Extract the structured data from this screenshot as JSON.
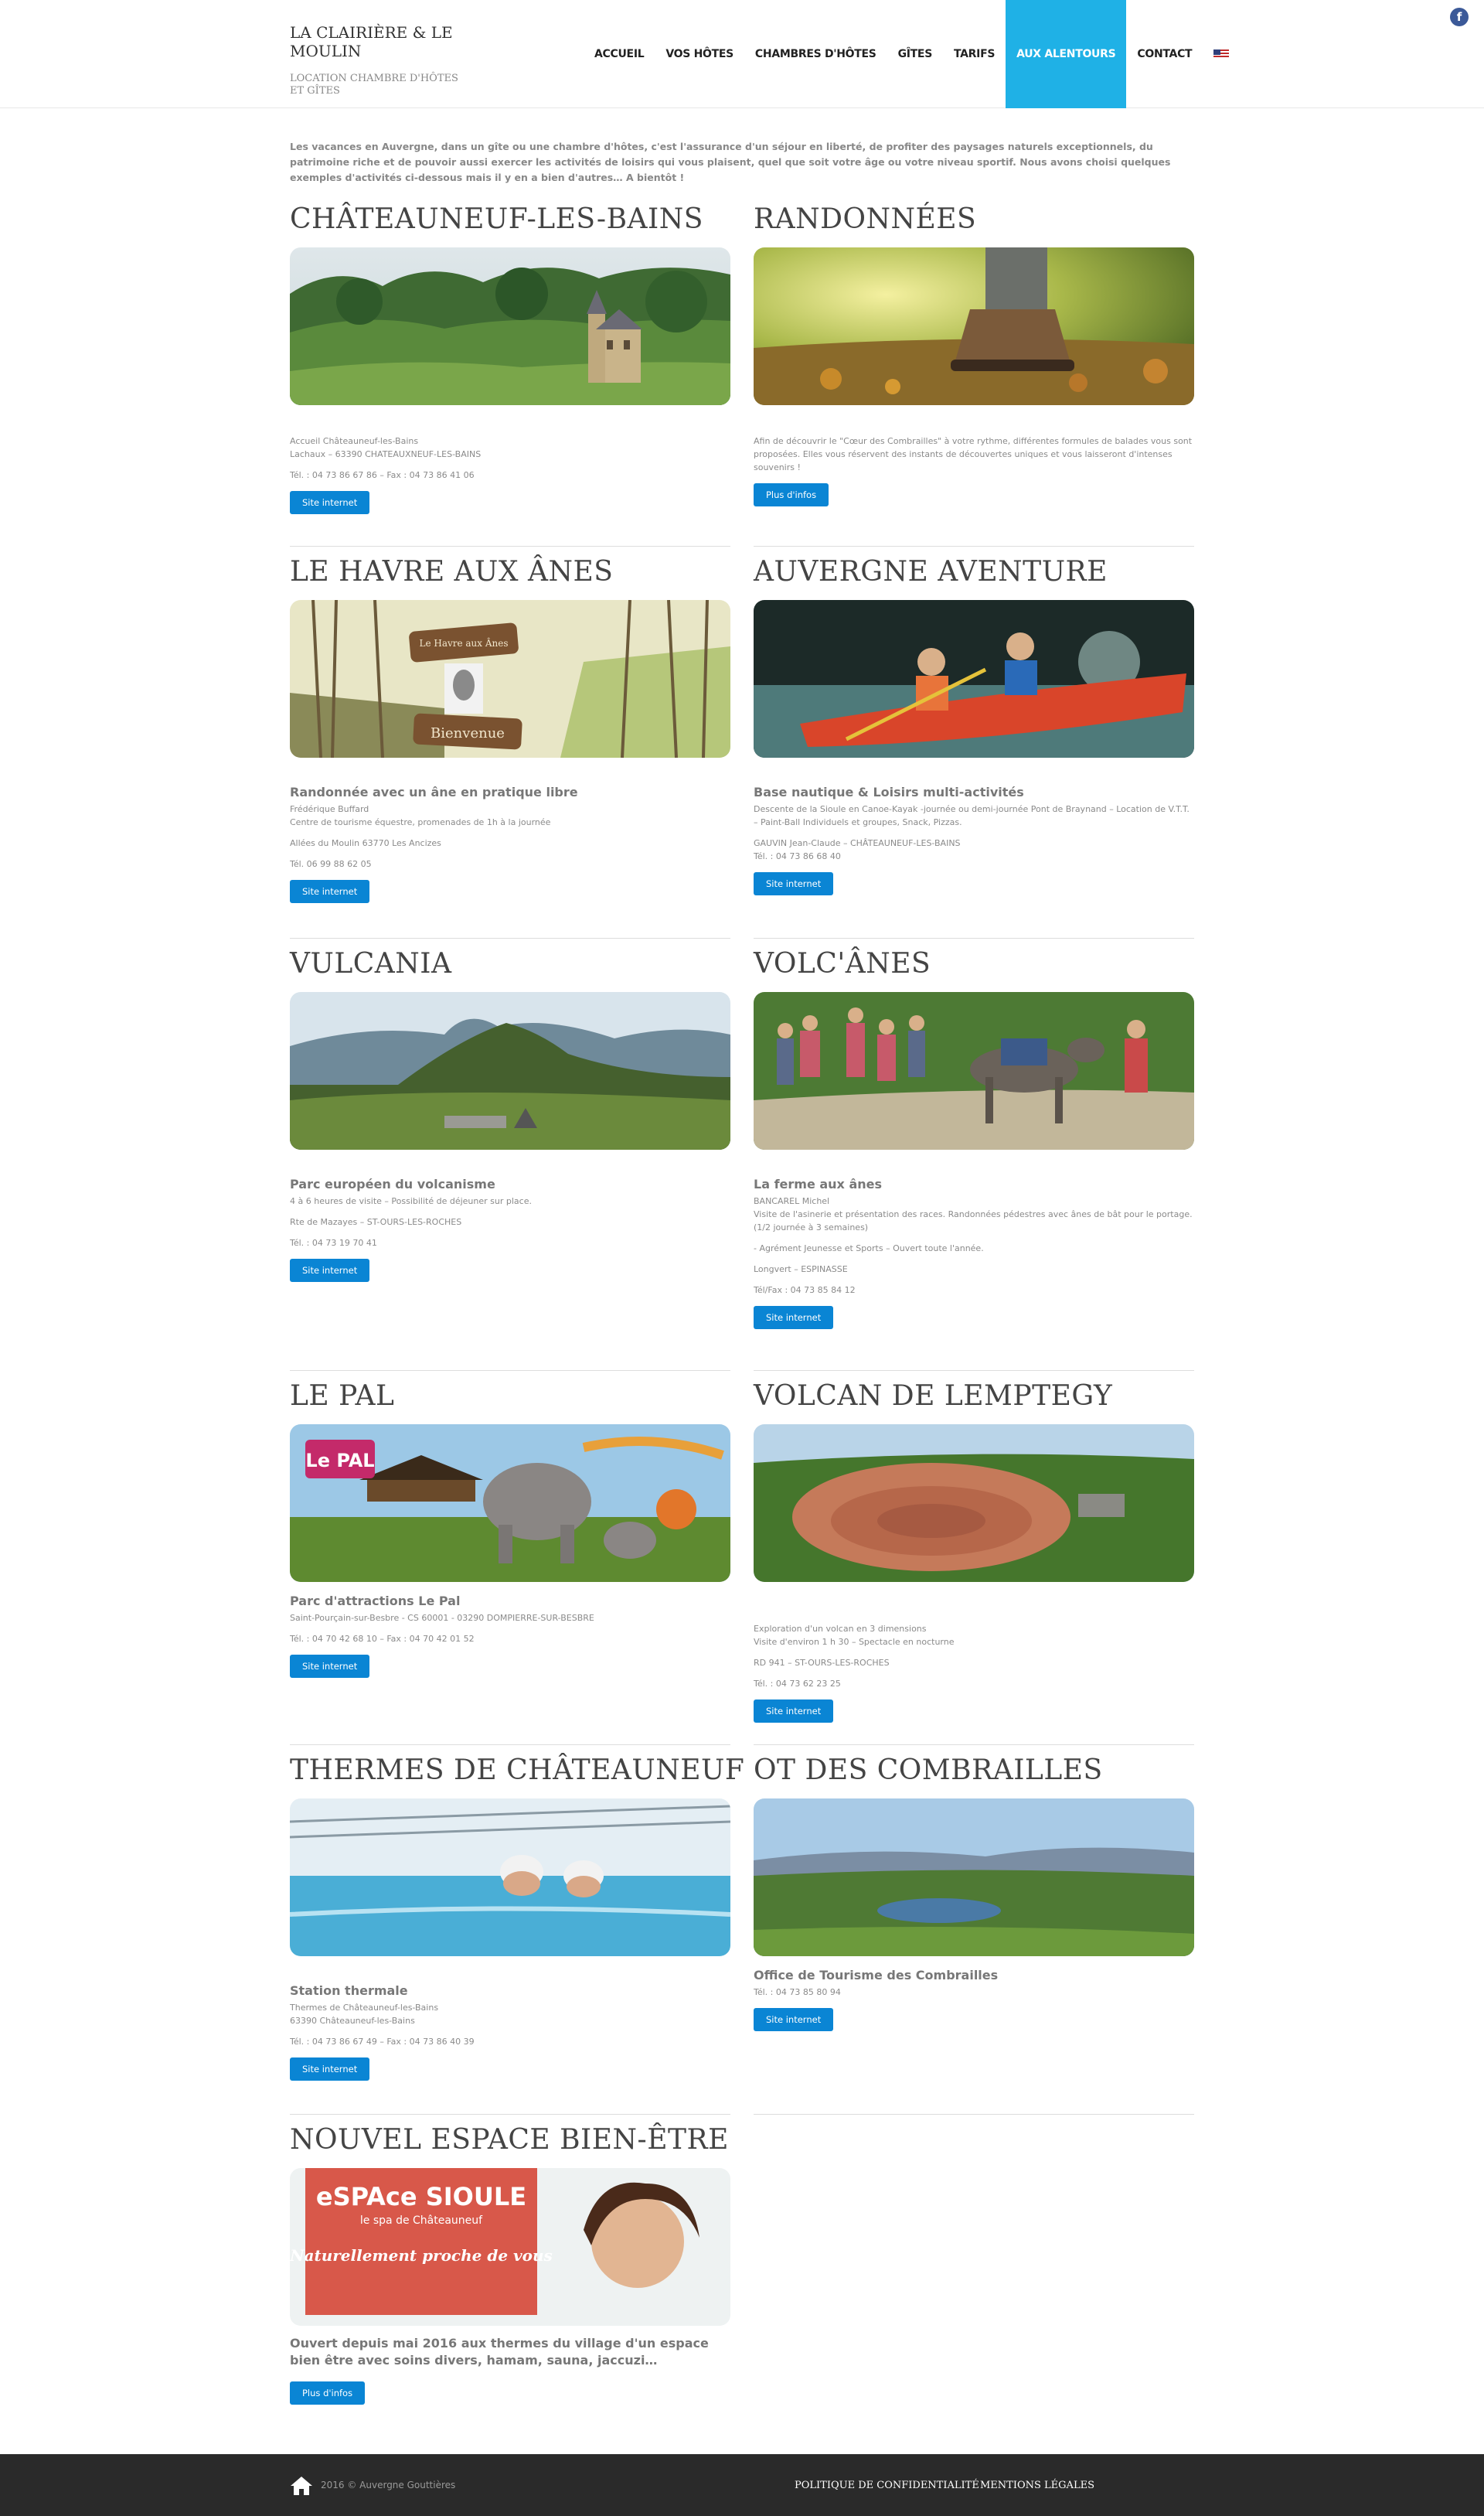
{
  "header": {
    "site_title": "LA CLAIRIÈRE & LE MOULIN",
    "site_subtitle": "LOCATION CHAMBRE D'HÔTES ET GÎTES",
    "nav": [
      "ACCUEIL",
      "VOS HÔTES",
      "CHAMBRES D'HÔTES",
      "GÎTES",
      "TARIFS",
      "AUX ALENTOURS",
      "CONTACT"
    ],
    "active_nav": "AUX ALENTOURS",
    "social_icon": "facebook-icon",
    "language_icon": "us-flag-icon"
  },
  "intro": "Les vacances en Auvergne, dans un gîte ou une chambre d'hôtes, c'est l'assurance d'un séjour en liberté, de profiter des paysages naturels exceptionnels, du patrimoine riche et de pouvoir aussi exercer les activités de loisirs qui vous plaisent, quel que soit votre âge ou votre niveau sportif. Nous avons choisi quelques exemples d'activités ci-dessous mais il y en a bien d'autres… A bientôt !",
  "cards": [
    {
      "title": "CHÂTEAUNEUF-LES-BAINS",
      "subtitle": "",
      "lines": [
        "Accueil Châteauneuf-les-Bains\nLachaux – 63390 CHATEAUXNEUF-LES-BAINS",
        "Tél. : 04 73 86 67 86 – Fax : 04 73 86 41 06"
      ],
      "button": "Site internet"
    },
    {
      "title": "RANDONNÉES",
      "subtitle": "",
      "lines": [
        "Afin de découvrir le \"Cœur des Combrailles\" à votre rythme, différentes formules de balades vous sont proposées. Elles vous réservent des instants de découvertes uniques et vous laisseront d'intenses souvenirs !"
      ],
      "button": "Plus d'infos"
    },
    {
      "title": "LE HAVRE AUX ÂNES",
      "subtitle": "Randonnée avec un âne en pratique libre",
      "lines": [
        "Frédérique Buffard\nCentre de tourisme équestre, promenades de 1h à la journée",
        "Allées du Moulin 63770 Les Ancizes",
        "Tél. 06 99 88 62 05"
      ],
      "button": "Site internet"
    },
    {
      "title": "AUVERGNE AVENTURE",
      "subtitle": "Base nautique & Loisirs multi-activités",
      "lines": [
        "Descente de la Sioule en Canoe-Kayak -journée ou demi-journée Pont de Braynand – Location de V.T.T. – Paint-Ball Individuels et groupes, Snack, Pizzas.",
        "GAUVIN Jean-Claude – CHÂTEAUNEUF-LES-BAINS\nTél. : 04 73 86 68 40"
      ],
      "button": "Site internet"
    },
    {
      "title": "VULCANIA",
      "subtitle": "Parc européen du volcanisme",
      "lines": [
        "4 à 6 heures de visite – Possibilité de déjeuner sur place.",
        "Rte de Mazayes – ST-OURS-LES-ROCHES",
        "Tél. : 04 73 19 70 41"
      ],
      "button": "Site internet"
    },
    {
      "title": "VOLC'ÂNES",
      "subtitle": "La ferme aux ânes",
      "lines": [
        "BANCAREL Michel\nVisite de l'asinerie et présentation des races. Randonnées pédestres avec ânes de bât pour le portage. (1/2 journée à 3 semaines)",
        "- Agrément Jeunesse et Sports – Ouvert toute l'année.",
        "Longvert – ESPINASSE",
        "Tél/Fax : 04 73 85 84 12"
      ],
      "button": "Site internet"
    },
    {
      "title": "LE PAL",
      "subtitle": "Parc d'attractions Le Pal",
      "lines": [
        "Saint-Pourçain-sur-Besbre - CS 60001 - 03290 DOMPIERRE-SUR-BESBRE",
        "Tél. : 04 70 42 68 10 – Fax : 04 70 42 01 52"
      ],
      "button": "Site internet"
    },
    {
      "title": "VOLCAN DE LEMPTEGY",
      "subtitle": "",
      "lines": [
        "Exploration d'un volcan en 3 dimensions\nVisite d'environ 1 h 30 – Spectacle en nocturne",
        "RD 941 – ST-OURS-LES-ROCHES",
        "Tél. : 04 73 62 23 25"
      ],
      "button": "Site internet"
    },
    {
      "title": "THERMES DE CHÂTEAUNEUF",
      "subtitle": "Station thermale",
      "lines": [
        "Thermes de Châteauneuf-les-Bains\n63390 Châteauneuf-les-Bains",
        "Tél. : 04 73 86 67 49 – Fax : 04 73 86 40 39"
      ],
      "button": "Site internet"
    },
    {
      "title": "OT DES COMBRAILLES",
      "subtitle": "Office de Tourisme des Combrailles",
      "lines": [
        "Tél. : 04 73 85 80 94"
      ],
      "button": "Site internet"
    },
    {
      "title": "NOUVEL ESPACE BIEN-ÊTRE",
      "subtitle": "Ouvert depuis mai 2016 aux thermes du village d'un espace bien être avec soins divers, hamam, sauna, jaccuzi…",
      "lines": [],
      "button": "Plus d'infos"
    }
  ],
  "espace_banner": {
    "brand_line1": "eSPAce SIOULE",
    "brand_line2": "le spa de Châteauneuf",
    "tagline": "Naturellement proche de vous"
  },
  "le_pal_logo": "Le PAL",
  "havre_sign": {
    "top": "Le Havre aux Ânes",
    "bottom": "Bienvenue"
  },
  "footer": {
    "copyright": "2016 © Auvergne Gouttières",
    "links": [
      "POLITIQUE DE CONFIDENTIALITÉ",
      "MENTIONS LÉGALES"
    ],
    "home_icon": "home-icon"
  },
  "colors": {
    "accent": "#1fb1e6",
    "button": "#0a85d4",
    "footer": "#2a2a2a"
  }
}
